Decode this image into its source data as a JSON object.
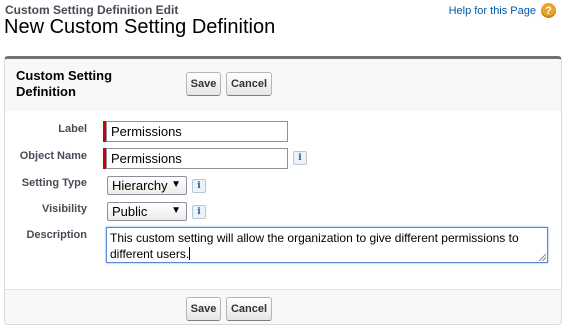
{
  "header": {
    "supertitle": "Custom Setting Definition Edit",
    "title": "New Custom Setting Definition",
    "help_link": "Help for this Page",
    "help_icon": "?"
  },
  "panel": {
    "title": "Custom Setting Definition",
    "save_label": "Save",
    "cancel_label": "Cancel"
  },
  "form": {
    "label_label": "Label",
    "label_value": "Permissions",
    "object_name_label": "Object Name",
    "object_name_value": "Permissions",
    "setting_type_label": "Setting Type",
    "setting_type_value": "Hierarchy",
    "visibility_label": "Visibility",
    "visibility_value": "Public",
    "description_label": "Description",
    "description_value": "This custom setting will allow the organization to give different permissions to different users.",
    "info_glyph": "i",
    "dropdown_arrow": "▼"
  },
  "colors": {
    "required_bar": "#cc0000",
    "help_icon": "#e8a32c",
    "link": "#015ba7"
  }
}
